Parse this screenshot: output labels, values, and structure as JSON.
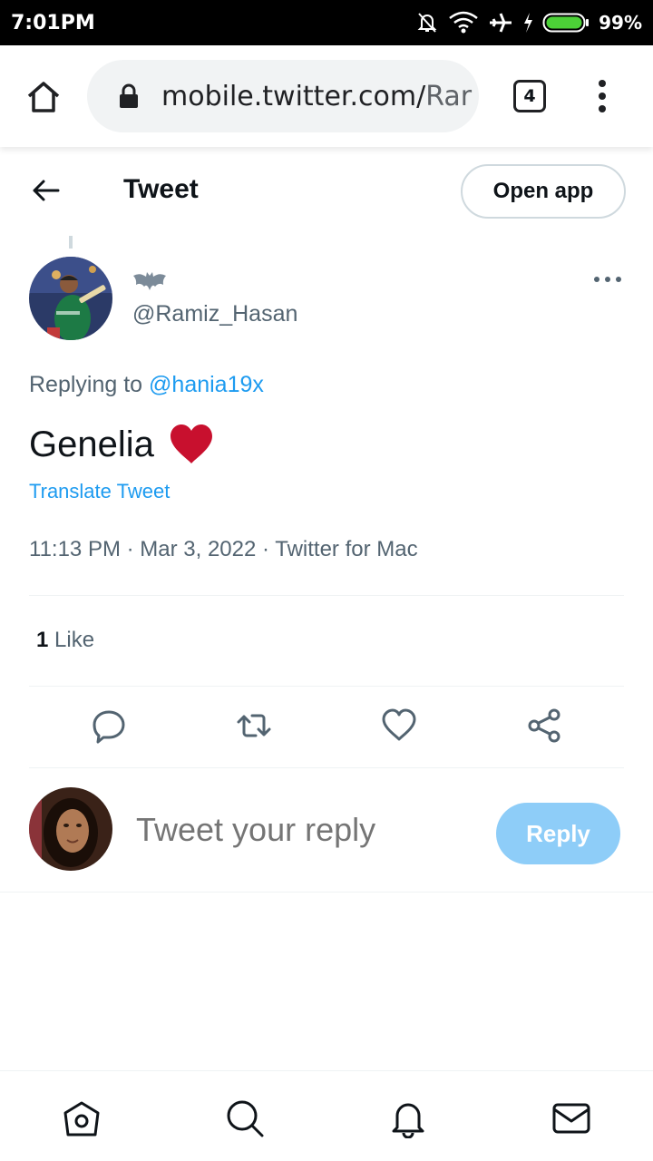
{
  "status_bar": {
    "time": "7:01PM",
    "battery": "99%",
    "icons": [
      "mute-bell-icon",
      "wifi-icon",
      "airplane-icon",
      "charging-icon",
      "battery-icon"
    ]
  },
  "browser": {
    "url_host": "mobile.twitter.com/",
    "url_rest": "Rar",
    "tab_count": "4"
  },
  "header": {
    "title": "Tweet",
    "open_app_label": "Open app"
  },
  "tweet": {
    "handle": "@Ramiz_Hasan",
    "replying_prefix": "Replying to ",
    "replying_to": "@hania19x",
    "text": "Genelia",
    "translate_label": "Translate Tweet",
    "meta": "11:13 PM · Mar 3, 2022 · Twitter for Mac",
    "likes_count": "1",
    "likes_label": " Like"
  },
  "compose": {
    "placeholder": "Tweet your reply",
    "reply_label": "Reply"
  },
  "colors": {
    "accent": "#1d9bf0",
    "reply_button": "#8ecdf8",
    "heart": "#c8102e",
    "muted": "#536471"
  }
}
